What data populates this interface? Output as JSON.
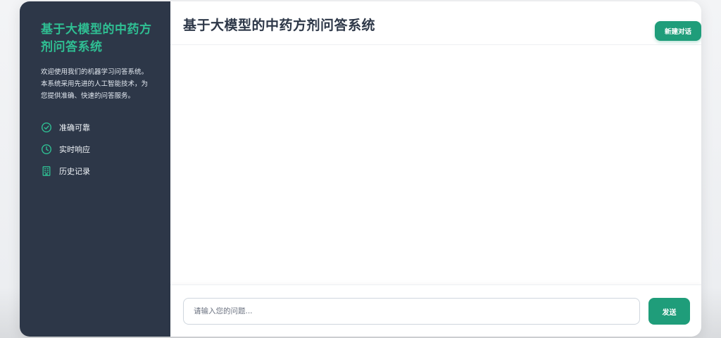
{
  "sidebar": {
    "title": "基于大模型的中药方剂问答系统",
    "description": "欢迎使用我们的机器学习问答系统。本系统采用先进的人工智能技术，为您提供准确、快速的问答服务。",
    "features": [
      {
        "icon": "check-circle-icon",
        "label": "准确可靠"
      },
      {
        "icon": "clock-icon",
        "label": "实时响应"
      },
      {
        "icon": "building-icon",
        "label": "历史记录"
      }
    ]
  },
  "header": {
    "title": "基于大模型的中药方剂问答系统",
    "new_chat_label": "新建对话"
  },
  "composer": {
    "placeholder": "请输入您的问题...",
    "value": "",
    "send_label": "发送"
  },
  "colors": {
    "accent": "#1f9d7a",
    "sidebar_bg": "#2d3748",
    "sidebar_title": "#2fbf93"
  }
}
